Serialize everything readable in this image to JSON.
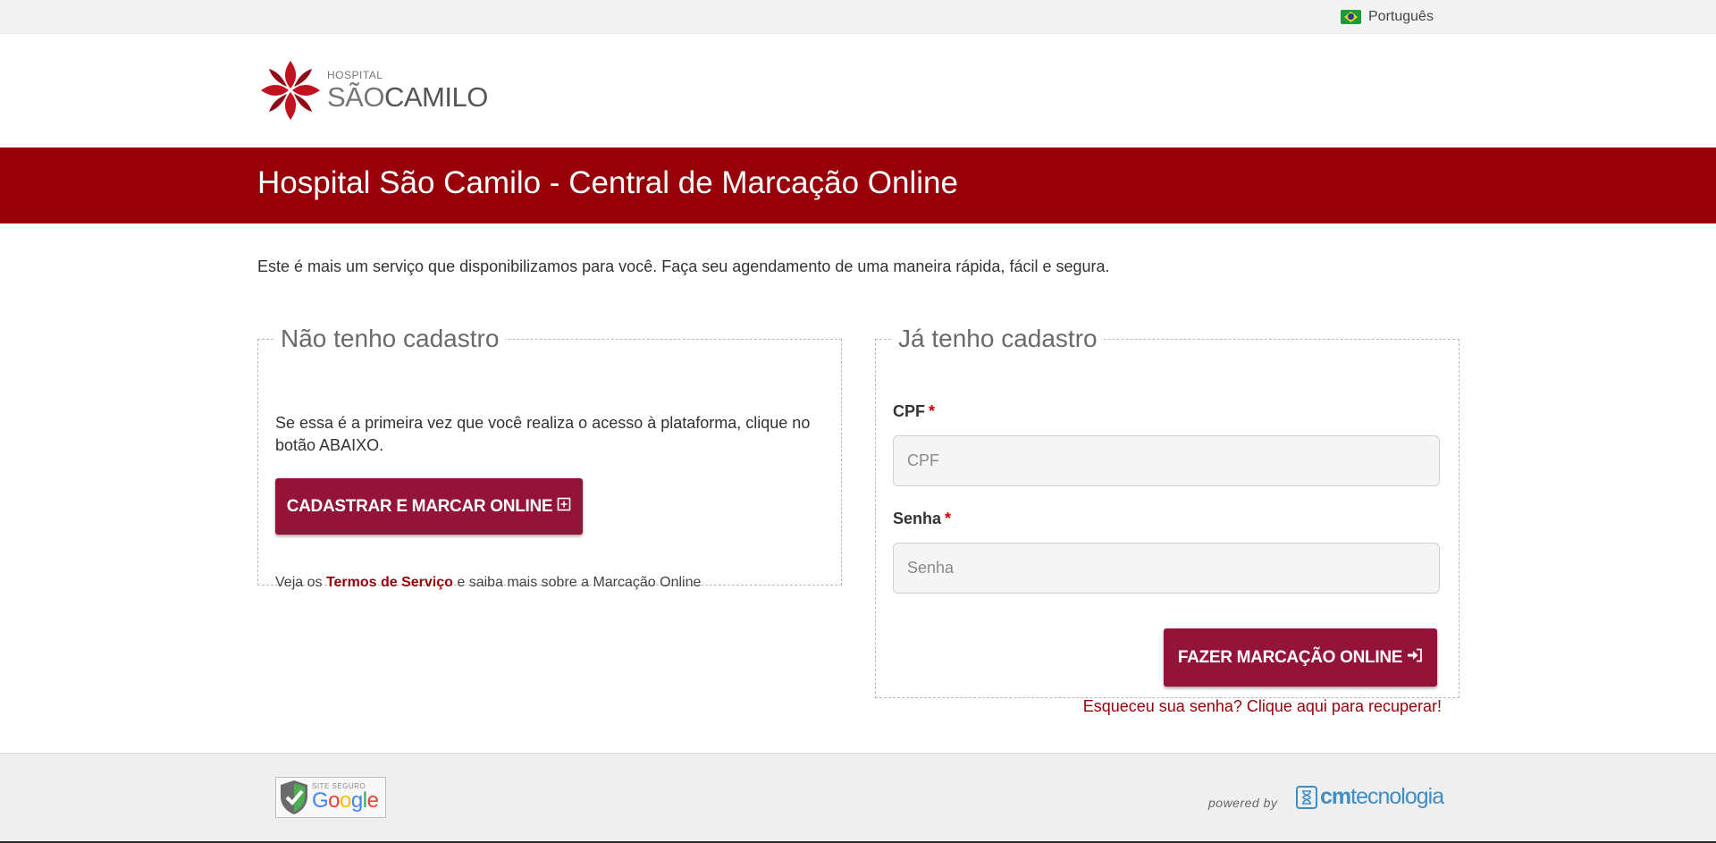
{
  "topbar": {
    "language_label": "Português",
    "flag_icon": "brazil-flag-icon"
  },
  "logo": {
    "hospital_text": "HOSPITAL",
    "name_part1": "SÃO",
    "name_part2": "CAMILO"
  },
  "banner": {
    "title": "Hospital São Camilo - Central de Marcação Online"
  },
  "intro": {
    "text": "Este é mais um serviço que disponibilizamos para você. Faça seu agendamento de uma maneira rápida, fácil e segura."
  },
  "new_user": {
    "legend": "Não tenho cadastro",
    "description": "Se essa é a primeira vez que você realiza o acesso à plataforma, clique no botão ABAIXO.",
    "register_button": "CADASTRAR E MARCAR ONLINE",
    "register_button_icon": "plus-square-icon",
    "terms_prefix": "Veja os",
    "terms_link": "Termos de Serviço",
    "terms_suffix": "e saiba mais sobre a Marcação Online"
  },
  "existing_user": {
    "legend": "Já tenho cadastro",
    "cpf_label": "CPF",
    "cpf_placeholder": "CPF",
    "cpf_value": "",
    "password_label": "Senha",
    "password_placeholder": "Senha",
    "password_value": "",
    "required_mark": "*",
    "login_button": "FAZER MARCAÇÃO ONLINE",
    "login_button_icon": "sign-in-icon",
    "forgot_link": "Esqueceu sua senha? Clique aqui para recuperar!"
  },
  "footer": {
    "badge_small_text": "SITE SEGURO",
    "badge_google": [
      "G",
      "o",
      "o",
      "g",
      "l",
      "e"
    ],
    "powered_by": "powered by",
    "cm_prefix": "cm",
    "cm_suffix": "tecnologia"
  },
  "colors": {
    "banner": "#970009",
    "button": "#931339",
    "link": "#970009",
    "required": "#d40000",
    "cm_blue": "#3d8ec7"
  }
}
